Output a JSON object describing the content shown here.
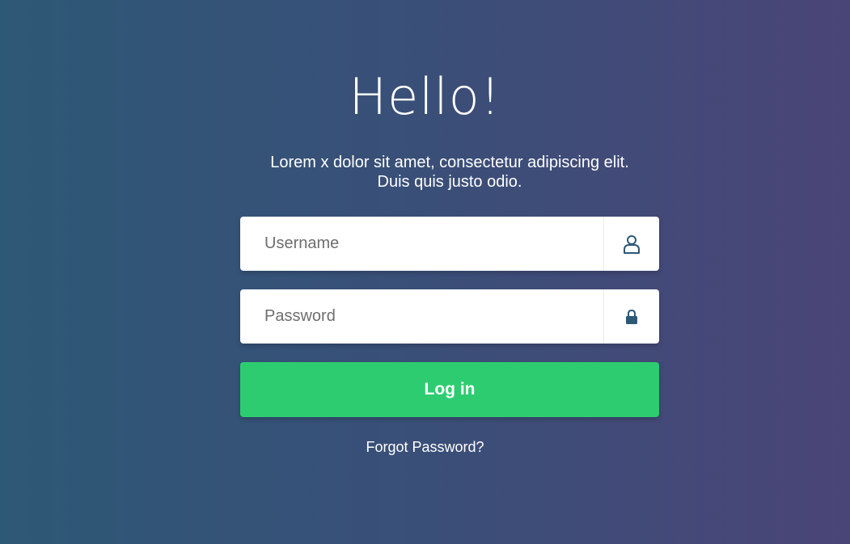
{
  "header": {
    "title": "Hello!",
    "subtitle": "Lorem x dolor sit amet, consectetur adipiscing elit. Duis quis justo odio."
  },
  "form": {
    "username": {
      "placeholder": "Username",
      "value": "",
      "icon": "user-icon"
    },
    "password": {
      "placeholder": "Password",
      "value": "",
      "icon": "lock-icon"
    },
    "login_label": "Log in",
    "forgot_label": "Forgot Password?"
  },
  "colors": {
    "background_start": "#2d5876",
    "background_end": "#4a4577",
    "button": "#2ecc71",
    "icon": "#2d5876"
  }
}
